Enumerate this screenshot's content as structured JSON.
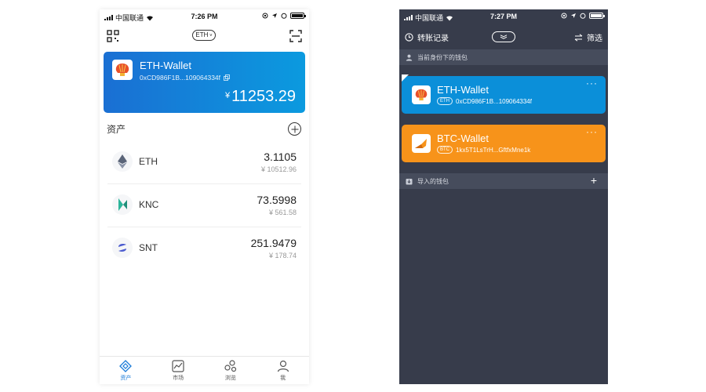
{
  "screen1": {
    "status": {
      "carrier": "中国联通",
      "time": "7:26 PM"
    },
    "network_label": "ETH",
    "wallet": {
      "name": "ETH-Wallet",
      "address": "0xCD986F1B...109064334f",
      "currency_symbol": "¥",
      "balance": "11253.29"
    },
    "assets_title": "资产",
    "assets": [
      {
        "symbol": "ETH",
        "amount": "3.1105",
        "fiat": "¥ 10512.96",
        "icon": "eth-icon"
      },
      {
        "symbol": "KNC",
        "amount": "73.5998",
        "fiat": "¥ 561.58",
        "icon": "knc-icon"
      },
      {
        "symbol": "SNT",
        "amount": "251.9479",
        "fiat": "¥ 178.74",
        "icon": "snt-icon"
      }
    ],
    "tabs": [
      {
        "label": "资产",
        "icon": "assets-icon",
        "active": true
      },
      {
        "label": "市场",
        "icon": "market-icon",
        "active": false
      },
      {
        "label": "浏览",
        "icon": "browse-icon",
        "active": false
      },
      {
        "label": "我",
        "icon": "profile-icon",
        "active": false
      }
    ]
  },
  "screen2": {
    "status": {
      "carrier": "中国联通",
      "time": "7:27 PM"
    },
    "history_label": "转账记录",
    "filter_label": "筛选",
    "identity_section": "当前身份下的钱包",
    "imported_section": "导入的钱包",
    "wallets": [
      {
        "name": "ETH-Wallet",
        "tag": "ETH",
        "address": "0xCD986F1B...109064334f",
        "color": "#0b8fd9"
      },
      {
        "name": "BTC-Wallet",
        "tag": "BTC",
        "address": "1kx5T1LsTrH...GftfxMne1k",
        "color": "#f7931a"
      }
    ],
    "more_label": "···"
  },
  "colors": {
    "accent_blue": "#1a7bd8",
    "dark_bg": "#373c4b",
    "section_bg": "#464c5c",
    "btc_orange": "#f7931a"
  }
}
